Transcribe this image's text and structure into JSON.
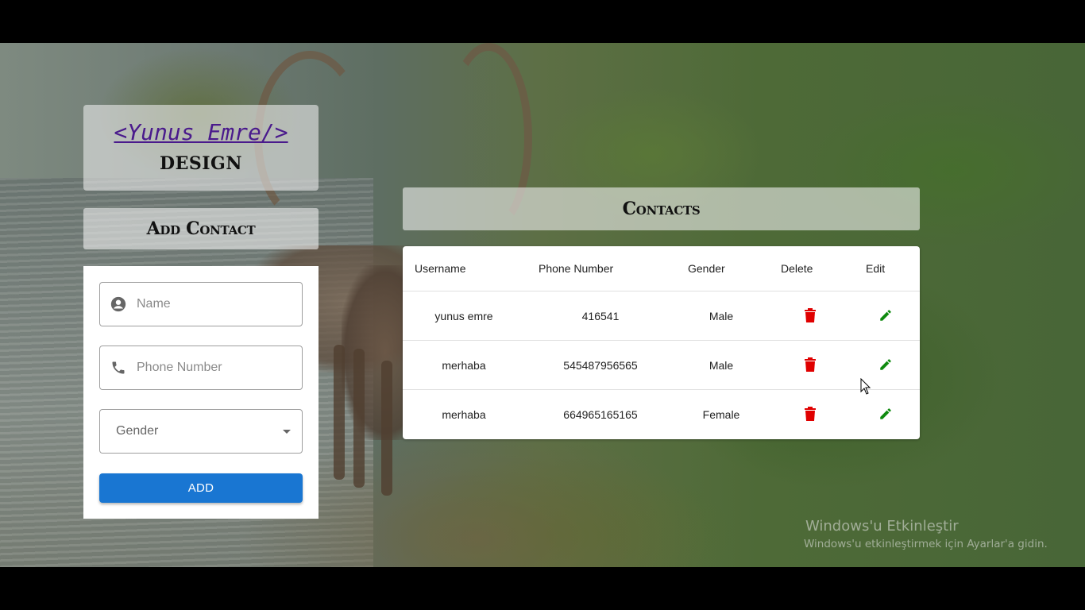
{
  "brand": {
    "title": "<Yunus Emre/>",
    "subtitle": "DESIGN"
  },
  "add_contact": {
    "title": "Add Contact",
    "name_placeholder": "Name",
    "phone_placeholder": "Phone Number",
    "gender_label": "Gender",
    "add_button": "ADD"
  },
  "contacts": {
    "title": "Contacts",
    "headers": {
      "username": "Username",
      "phone": "Phone Number",
      "gender": "Gender",
      "delete": "Delete",
      "edit": "Edit"
    },
    "rows": [
      {
        "username": "yunus emre",
        "phone": "416541",
        "gender": "Male"
      },
      {
        "username": "merhaba",
        "phone": "545487956565",
        "gender": "Male"
      },
      {
        "username": "merhaba",
        "phone": "664965165165",
        "gender": "Female"
      }
    ]
  },
  "icons": {
    "name_field": "account-circle-icon",
    "phone_field": "phone-icon",
    "gender_dropdown": "chevron-down-icon",
    "delete": "trash-icon",
    "edit": "pencil-icon"
  },
  "colors": {
    "primary": "#1976d2",
    "delete": "#e00000",
    "edit": "#0f8a0f",
    "brand_link": "#4a1a8c"
  },
  "watermark": {
    "title": "Windows'u Etkinleştir",
    "subtitle": "Windows'u etkinleştirmek için Ayarlar'a gidin."
  }
}
